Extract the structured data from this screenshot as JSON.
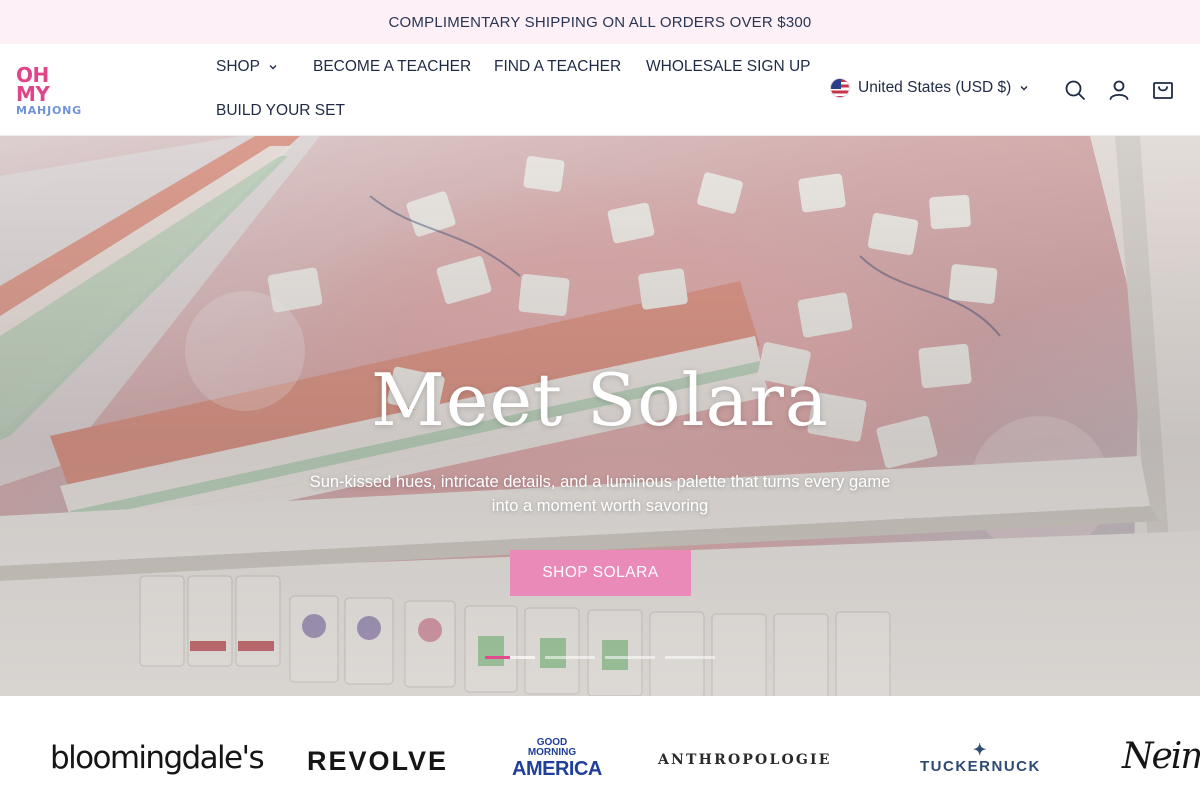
{
  "announcement": {
    "text": "COMPLIMENTARY SHIPPING ON ALL ORDERS OVER $300"
  },
  "logo": {
    "line1": "OH",
    "line2": "MY",
    "line3": "MAHJONG"
  },
  "nav": {
    "items": [
      {
        "label": "SHOP",
        "has_dropdown": true
      },
      {
        "label": "BECOME A TEACHER"
      },
      {
        "label": "FIND A TEACHER"
      },
      {
        "label": "WHOLESALE SIGN UP"
      },
      {
        "label": "BUILD YOUR SET"
      }
    ]
  },
  "locale": {
    "label": "United States (USD $)",
    "flag_icon": "us-flag-icon"
  },
  "header_icons": [
    "search-icon",
    "account-icon",
    "cart-icon"
  ],
  "hero": {
    "title": "Meet Solara",
    "subtitle": "Sun-kissed hues, intricate details, and a luminous palette that turns every game into a moment worth savoring",
    "cta_label": "SHOP SOLARA",
    "slides": 4,
    "active_slide": 1,
    "active_progress": 0.5
  },
  "press": {
    "bloomingdales": "bloomingdale's",
    "revolve": "REVOLVE",
    "gma_line1": "GOOD",
    "gma_line2": "MORNING",
    "gma_line3": "AMERICA",
    "anthropologie": "ANTHROPOLOGIE",
    "tuckernuck": "TUCKERNUCK",
    "neiman": "NeimanMarcus"
  },
  "colors": {
    "accent_pink": "#e98ab8",
    "announcement_bg": "#fdf0f6",
    "text_navy": "#1f2a44",
    "logo_pink": "#e0458a",
    "logo_blue": "#6f93d9"
  }
}
